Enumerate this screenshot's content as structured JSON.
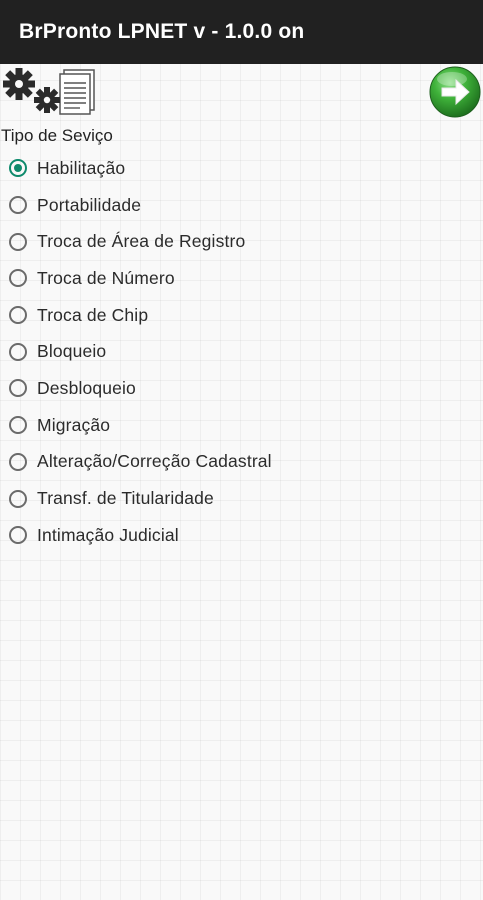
{
  "app_bar": {
    "title": "BrPronto LPNET v - 1.0.0 on"
  },
  "toolbar": {
    "settings_icon": "gears-document-icon",
    "next_icon": "green-arrow-right-icon"
  },
  "service_type": {
    "label": "Tipo de Seviço",
    "selected": "Habilitação",
    "options": [
      {
        "label": "Habilitação",
        "checked": true
      },
      {
        "label": "Portabilidade",
        "checked": false
      },
      {
        "label": "Troca de Área de Registro",
        "checked": false
      },
      {
        "label": "Troca de Número",
        "checked": false
      },
      {
        "label": "Troca de Chip",
        "checked": false
      },
      {
        "label": "Bloqueio",
        "checked": false
      },
      {
        "label": "Desbloqueio",
        "checked": false
      },
      {
        "label": "Migração",
        "checked": false
      },
      {
        "label": "Alteração/Correção Cadastral",
        "checked": false
      },
      {
        "label": "Transf. de Titularidade",
        "checked": false
      },
      {
        "label": "Intimação Judicial",
        "checked": false
      }
    ]
  },
  "colors": {
    "app_bar": "#212121",
    "accent": "#0e8a6c",
    "next_button": "#2e9b2e"
  }
}
